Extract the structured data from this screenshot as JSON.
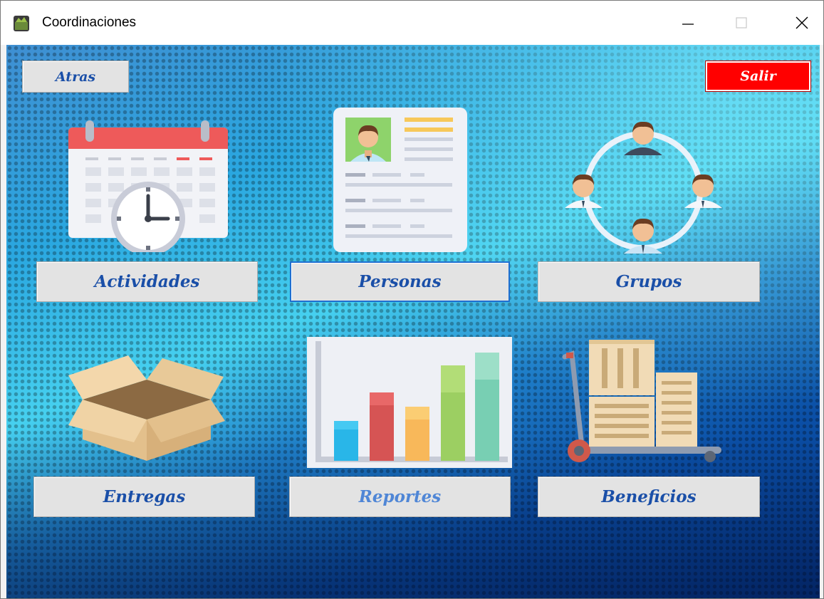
{
  "window": {
    "title": "Coordinaciones",
    "controls": [
      "minimize",
      "maximize",
      "close"
    ]
  },
  "toolbar": {
    "back_label": "Atras",
    "exit_label": "Salir"
  },
  "menu": {
    "actividades": "Actividades",
    "personas": "Personas",
    "grupos": "Grupos",
    "entregas": "Entregas",
    "reportes": "Reportes",
    "beneficios": "Beneficios"
  },
  "icons": {
    "actividades": "calendar-clock-icon",
    "personas": "profile-card-icon",
    "grupos": "people-network-icon",
    "entregas": "open-box-icon",
    "reportes": "bar-chart-icon",
    "beneficios": "hand-truck-boxes-icon"
  },
  "colors": {
    "button_text": "#1a4fa8",
    "exit_bg": "#ff0000"
  }
}
